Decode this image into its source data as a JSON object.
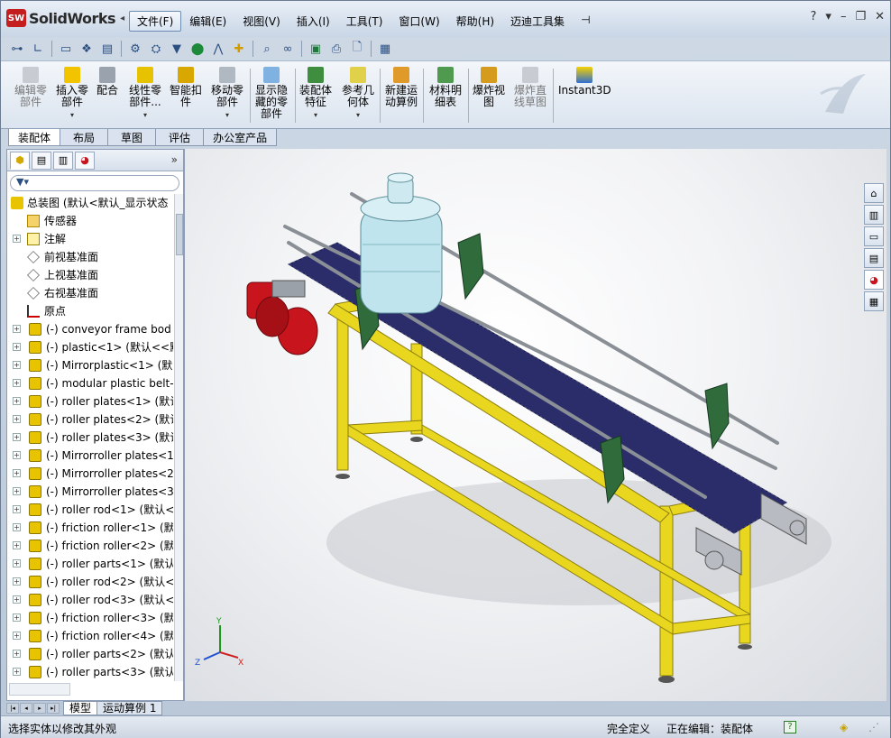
{
  "app": {
    "logo_badge": "SW",
    "name": "SolidWorks"
  },
  "menu": [
    {
      "label": "文件(F)",
      "active": true
    },
    {
      "label": "编辑(E)"
    },
    {
      "label": "视图(V)"
    },
    {
      "label": "插入(I)"
    },
    {
      "label": "工具(T)"
    },
    {
      "label": "窗口(W)"
    },
    {
      "label": "帮助(H)"
    },
    {
      "label": "迈迪工具集"
    }
  ],
  "window_controls": {
    "help": "?",
    "dropdown": "▾",
    "minimize": "–",
    "restore": "❐",
    "close": "✕"
  },
  "command_manager": [
    {
      "label": "编辑零部件",
      "disabled": true
    },
    {
      "label": "插入零部件",
      "dropdown": true
    },
    {
      "label": "配合"
    },
    {
      "label": "线性零部件...",
      "dropdown": true
    },
    {
      "label": "智能扣件"
    },
    {
      "label": "移动零部件",
      "dropdown": true
    },
    {
      "label": "显示隐藏的零部件"
    },
    {
      "label": "装配体特征",
      "dropdown": true
    },
    {
      "label": "参考几何体",
      "dropdown": true
    },
    {
      "label": "新建运动算例"
    },
    {
      "label": "材料明细表"
    },
    {
      "label": "爆炸视图"
    },
    {
      "label": "爆炸直线草图",
      "disabled": true
    },
    {
      "label": "Instant3D"
    }
  ],
  "tabs": [
    "装配体",
    "布局",
    "草图",
    "评估",
    "办公室产品"
  ],
  "active_tab": "装配体",
  "feature_tree": {
    "root": "总装图 (默认<默认_显示状态",
    "items": [
      {
        "label": "传感器",
        "icon": "sensor-folder"
      },
      {
        "label": "注解",
        "icon": "annotation",
        "expandable": true
      },
      {
        "label": "前视基准面",
        "icon": "plane"
      },
      {
        "label": "上视基准面",
        "icon": "plane"
      },
      {
        "label": "右视基准面",
        "icon": "plane"
      },
      {
        "label": "原点",
        "icon": "origin"
      },
      {
        "label": "(-) conveyor frame bod",
        "icon": "part",
        "expandable": true
      },
      {
        "label": "(-) plastic<1> (默认<<默",
        "icon": "part",
        "expandable": true
      },
      {
        "label": "(-) Mirrorplastic<1> (默",
        "icon": "part",
        "expandable": true
      },
      {
        "label": "(-) modular plastic belt-",
        "icon": "part",
        "expandable": true
      },
      {
        "label": "(-) roller plates<1> (默认",
        "icon": "part",
        "expandable": true
      },
      {
        "label": "(-) roller plates<2> (默认",
        "icon": "part",
        "expandable": true
      },
      {
        "label": "(-) roller plates<3> (默认",
        "icon": "part",
        "expandable": true
      },
      {
        "label": "(-) Mirrorroller plates<1",
        "icon": "part",
        "expandable": true
      },
      {
        "label": "(-) Mirrorroller plates<2",
        "icon": "part",
        "expandable": true
      },
      {
        "label": "(-) Mirrorroller plates<3",
        "icon": "part",
        "expandable": true
      },
      {
        "label": "(-) roller rod<1> (默认<",
        "icon": "part",
        "expandable": true
      },
      {
        "label": "(-) friction roller<1> (默",
        "icon": "part",
        "expandable": true
      },
      {
        "label": "(-) friction roller<2> (默",
        "icon": "part",
        "expandable": true
      },
      {
        "label": "(-) roller parts<1> (默认",
        "icon": "part",
        "expandable": true
      },
      {
        "label": "(-) roller rod<2> (默认<",
        "icon": "part",
        "expandable": true
      },
      {
        "label": "(-) roller rod<3> (默认<",
        "icon": "part",
        "expandable": true
      },
      {
        "label": "(-) friction roller<3> (默",
        "icon": "part",
        "expandable": true
      },
      {
        "label": "(-) friction roller<4> (默",
        "icon": "part",
        "expandable": true
      },
      {
        "label": "(-) roller parts<2> (默认",
        "icon": "part",
        "expandable": true
      },
      {
        "label": "(-) roller parts<3> (默认",
        "icon": "part",
        "expandable": true
      }
    ]
  },
  "bottom_tabs": [
    "模型",
    "运动算例 1"
  ],
  "status": {
    "message": "选择实体以修改其外观",
    "definition": "完全定义",
    "editing": "正在编辑：装配体"
  },
  "colors": {
    "frame": "#e8d71e",
    "belt": "#2b2d6b",
    "motor": "#c8141c",
    "bottle": "#bfe4ee",
    "guide": "#2f6b3b"
  }
}
